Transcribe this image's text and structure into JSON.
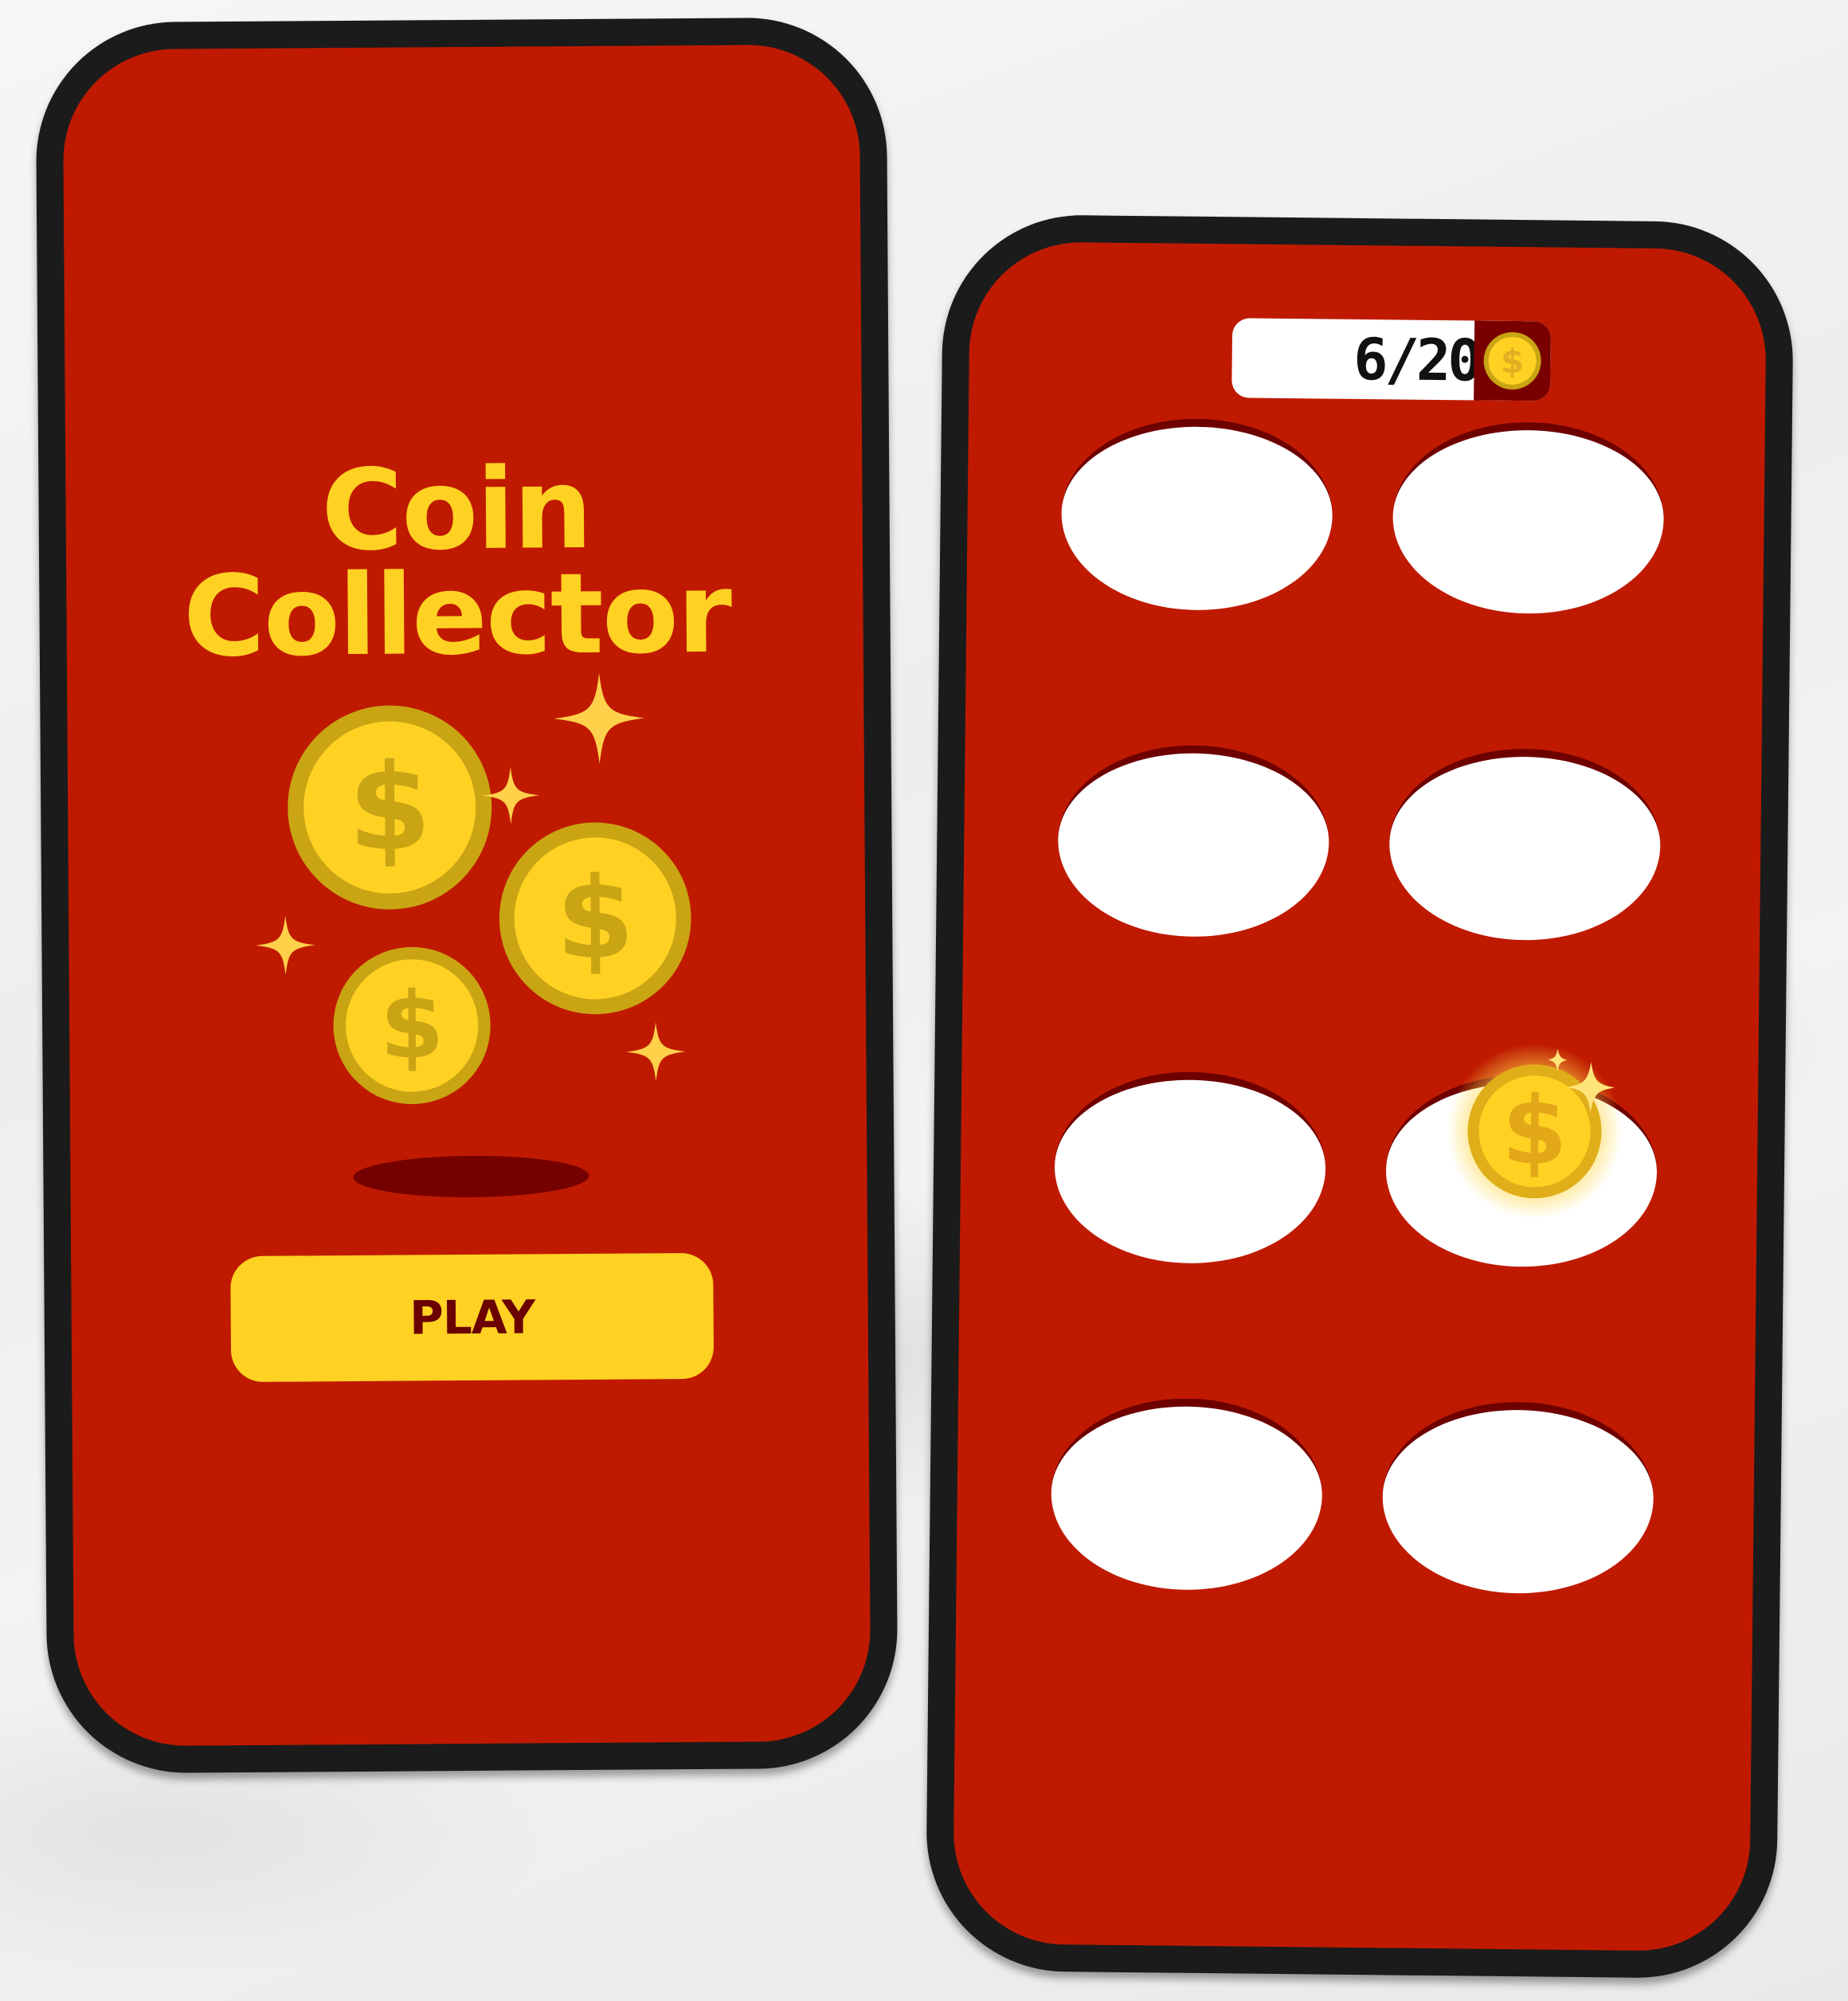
{
  "start_screen": {
    "title_line1": "Coin",
    "title_line2": "Collector",
    "play_label": "PLAY"
  },
  "game_screen": {
    "score": "6/20",
    "holes_count": 8,
    "coin_in_hole_index": 5
  },
  "colors": {
    "screen_red": "#bf1a00",
    "coin_yellow": "#ffd123",
    "coin_rim": "#c9a514",
    "dark_red": "#750000",
    "frame": "#1b1b1b"
  },
  "icons": [
    "coin-icon",
    "dollar-sign-icon",
    "sparkle-icon"
  ]
}
